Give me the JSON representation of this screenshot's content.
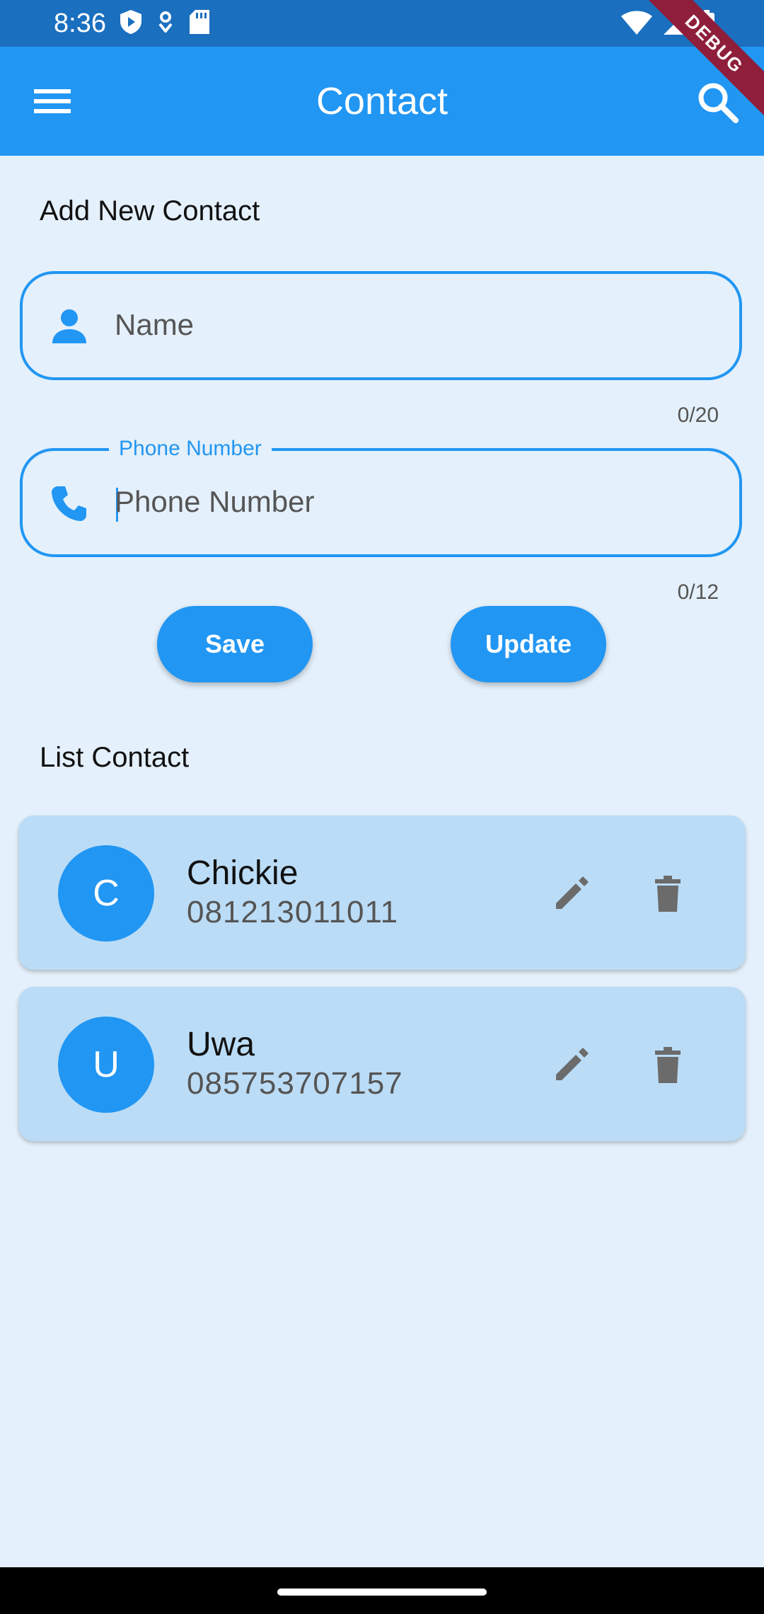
{
  "status_bar": {
    "time": "8:36",
    "left_icons": [
      "shield-icon",
      "location-icon",
      "sd-card-icon"
    ],
    "right_icons": [
      "wifi-icon",
      "signal-icon",
      "battery-icon"
    ]
  },
  "app_bar": {
    "title": "Contact",
    "menu_icon": "menu-icon",
    "search_icon": "search-icon",
    "background": "#2196f3"
  },
  "debug_banner": "DEBUG",
  "form": {
    "section_title": "Add New Contact",
    "name_field": {
      "placeholder": "Name",
      "value": "",
      "counter": "0/20",
      "icon": "person-icon"
    },
    "phone_field": {
      "label": "Phone Number",
      "placeholder": "Phone Number",
      "value": "",
      "counter": "0/12",
      "icon": "phone-icon"
    },
    "save_label": "Save",
    "update_label": "Update"
  },
  "list": {
    "section_title": "List Contact",
    "contacts": [
      {
        "initial": "C",
        "name": "Chickie",
        "phone": "081213011011"
      },
      {
        "initial": "U",
        "name": "Uwa",
        "phone": "085753707157"
      }
    ]
  },
  "colors": {
    "accent": "#2196f3",
    "card": "#bbdcf6",
    "background": "#e4f0fb",
    "icon_gray": "#6b6b6b"
  }
}
